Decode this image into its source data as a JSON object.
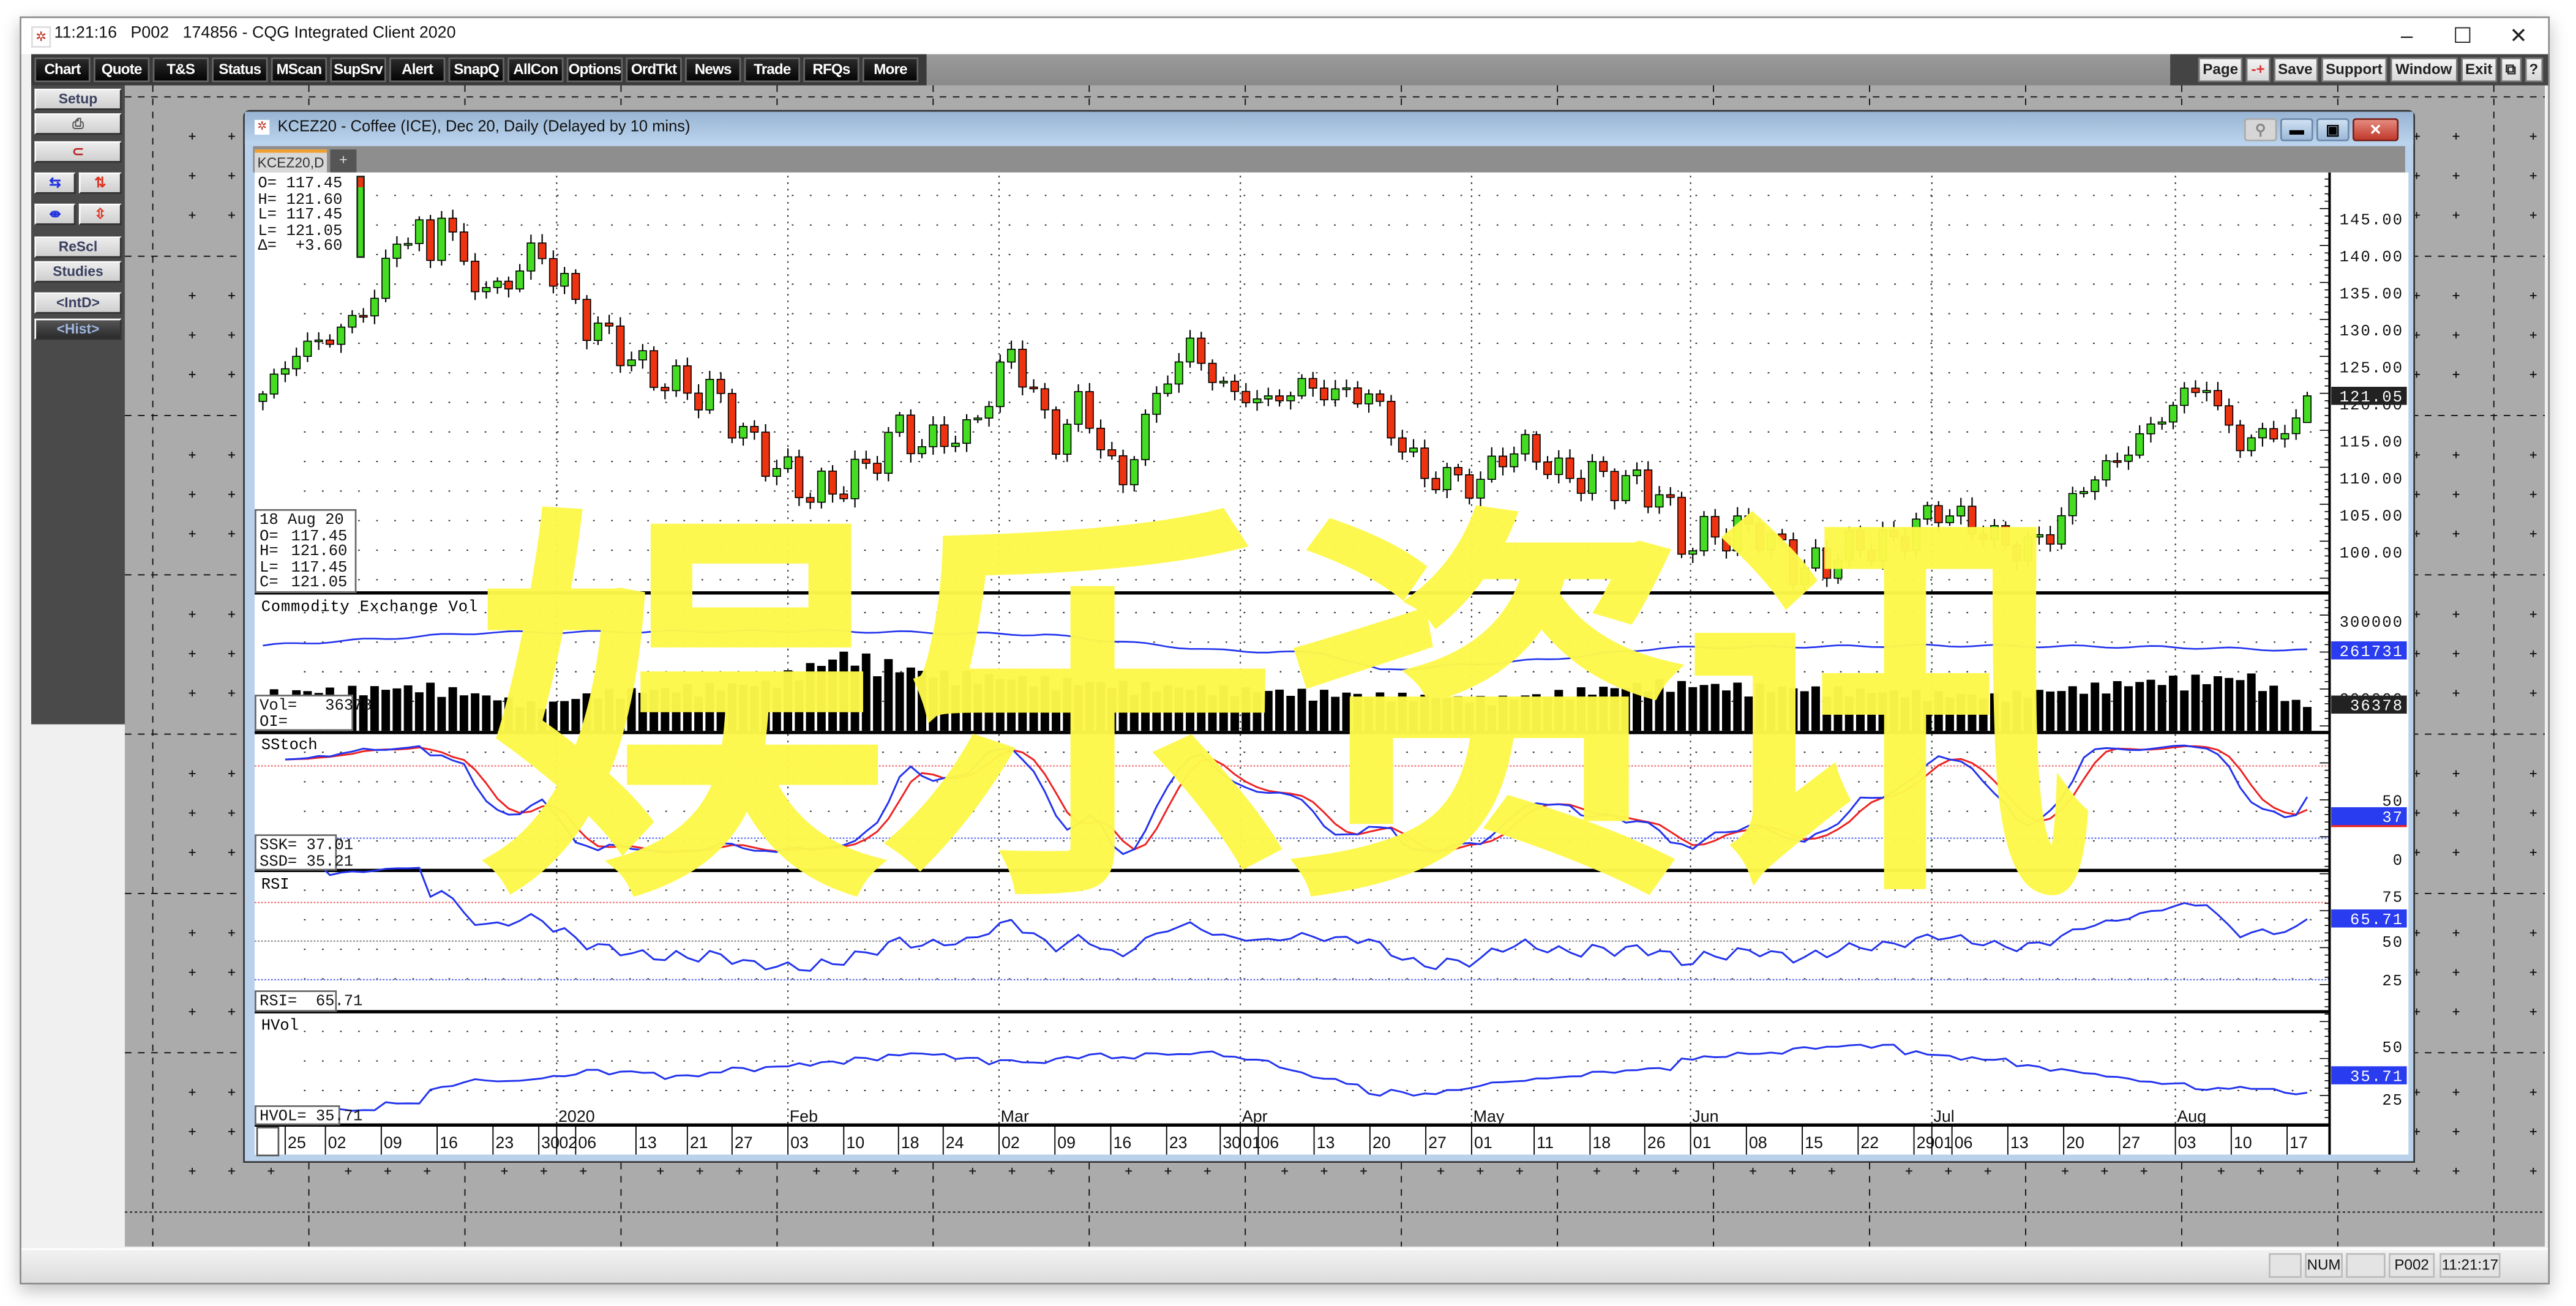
{
  "app": {
    "title": "11:21:16   P002   174856 - CQG Integrated Client 2020",
    "controls": {
      "minimize": "–",
      "maximize": "☐",
      "close": "✕"
    }
  },
  "toolbar": {
    "left": [
      "Chart",
      "Quote",
      "T&S",
      "Status",
      "MScan",
      "SupSrv",
      "Alert",
      "SnapQ",
      "AllCon",
      "Options",
      "OrdTkt",
      "News",
      "Trade",
      "RFQs",
      "More"
    ],
    "right": [
      "Page",
      "-+",
      "Save",
      "Support",
      "Window",
      "Exit"
    ],
    "restore_icon": "⧉",
    "help": "?"
  },
  "side_panel": {
    "setup": "Setup",
    "rescl": "ReScl",
    "studies": "Studies",
    "intd": "<IntD>",
    "hist": "<Hist>"
  },
  "chart_window": {
    "title": "KCEZ20 - Coffee (ICE), Dec 20, Daily (Delayed by 10 mins)",
    "tab": "KCEZ20,D",
    "add_tab": "+"
  },
  "ohlc_box": [
    {
      "k": "O=",
      "v": "117.45"
    },
    {
      "k": "H=",
      "v": "121.60"
    },
    {
      "k": "L=",
      "v": "117.45"
    },
    {
      "k": "L=",
      "v": "121.05"
    },
    {
      "k": "Δ=",
      "v": "+3.60"
    }
  ],
  "cursor_box": {
    "date": "18 Aug 20",
    "rows": [
      {
        "k": "O=",
        "v": "117.45"
      },
      {
        "k": "H=",
        "v": "121.60"
      },
      {
        "k": "L=",
        "v": "117.45"
      },
      {
        "k": "C=",
        "v": "121.05"
      }
    ]
  },
  "panels": {
    "volume": {
      "title": "Commodity Exchange Vol",
      "vol_label": "Vol=",
      "vol_value": "36378",
      "oi_label": "OI=",
      "oi_value": ""
    },
    "stoch": {
      "title": "SStoch",
      "ssk_label": "SSK=",
      "ssk_value": "37.01",
      "ssd_label": "SSD=",
      "ssd_value": "35.21"
    },
    "rsi": {
      "title": "RSI",
      "label": "RSI=",
      "value": "65.71"
    },
    "hvol": {
      "title": "HVol",
      "label": "HVOL=",
      "value": "35.71"
    }
  },
  "axes": {
    "price_ticks": [
      "145.00",
      "140.00",
      "135.00",
      "130.00",
      "125.00",
      "120.00",
      "115.00",
      "110.00",
      "105.00",
      "100.00"
    ],
    "price_current": "121.05",
    "volume_ticks": [
      "300000",
      "200000"
    ],
    "oi_current": "261731",
    "volume_current": "36378",
    "stoch_ticks": [
      "50",
      "0"
    ],
    "stoch_current": "37",
    "rsi_ticks": [
      "75",
      "50",
      "25"
    ],
    "rsi_current": "65.71",
    "hvol_ticks": [
      "50",
      "25"
    ],
    "hvol_current": "35.71"
  },
  "status_bar": {
    "num": "NUM",
    "page": "P002",
    "time": "11:21:17"
  },
  "watermark": "娱乐资讯",
  "colors": {
    "up": "#44dd22",
    "down": "#ee3311",
    "line_blue": "#2233ee",
    "line_red": "#ee2222",
    "watermark": "#fdf84a",
    "desktop": "#ababab"
  },
  "chart_data": {
    "type": "candlestick",
    "symbol": "KCEZ20",
    "bar_count": 184,
    "last_bar": {
      "open": 117.45,
      "high": 121.6,
      "low": 117.45,
      "close": 121.05
    },
    "ylim": [
      96,
      150
    ],
    "price_waypoints": [
      [
        0,
        121.3
      ],
      [
        3,
        127
      ],
      [
        6,
        129
      ],
      [
        8,
        131
      ],
      [
        10,
        134.6
      ],
      [
        12,
        142
      ],
      [
        14,
        143.5
      ],
      [
        15,
        139
      ],
      [
        16,
        146.7
      ],
      [
        18,
        138
      ],
      [
        21,
        134.6
      ],
      [
        23,
        139
      ],
      [
        25,
        140
      ],
      [
        27,
        135.7
      ],
      [
        29,
        131
      ],
      [
        32,
        127.5
      ],
      [
        34,
        124.6
      ],
      [
        37,
        122.4
      ],
      [
        41,
        120.6
      ],
      [
        43,
        115.7
      ],
      [
        46,
        111.3
      ],
      [
        49,
        108
      ],
      [
        51,
        108.4
      ],
      [
        54,
        111.3
      ],
      [
        57,
        116.8
      ],
      [
        59,
        114.2
      ],
      [
        61,
        115.7
      ],
      [
        63,
        115.7
      ],
      [
        65,
        121.3
      ],
      [
        67,
        126.8
      ],
      [
        69,
        121.3
      ],
      [
        71,
        114.6
      ],
      [
        73,
        120.2
      ],
      [
        75,
        114.6
      ],
      [
        77,
        109
      ],
      [
        79,
        118
      ],
      [
        81,
        123.5
      ],
      [
        83,
        128
      ],
      [
        85,
        123.5
      ],
      [
        87,
        121.3
      ],
      [
        90,
        120.2
      ],
      [
        93,
        122.4
      ],
      [
        96,
        121.3
      ],
      [
        99,
        121.3
      ],
      [
        101,
        116.4
      ],
      [
        104,
        110.2
      ],
      [
        107,
        109.7
      ],
      [
        109,
        109
      ],
      [
        111,
        113.5
      ],
      [
        114,
        113.5
      ],
      [
        116,
        110.2
      ],
      [
        119,
        110.2
      ],
      [
        123,
        109
      ],
      [
        125,
        108
      ],
      [
        127,
        101.3
      ],
      [
        130,
        102.4
      ],
      [
        134,
        103
      ],
      [
        137,
        98
      ],
      [
        140,
        98
      ],
      [
        141,
        100.2
      ],
      [
        146,
        101.3
      ],
      [
        150,
        105.8
      ],
      [
        153,
        103.5
      ],
      [
        157,
        100.2
      ],
      [
        160,
        102.4
      ],
      [
        163,
        109
      ],
      [
        166,
        112.4
      ],
      [
        169,
        116.8
      ],
      [
        172,
        121.3
      ],
      [
        174,
        122.4
      ],
      [
        175,
        119
      ],
      [
        177,
        114.6
      ],
      [
        179,
        115.7
      ],
      [
        182,
        116.8
      ],
      [
        183,
        121.05
      ]
    ],
    "volume_waypoints": [
      [
        0,
        60000
      ],
      [
        15,
        70000
      ],
      [
        25,
        40000
      ],
      [
        30,
        60000
      ],
      [
        45,
        75000
      ],
      [
        52,
        120000
      ],
      [
        60,
        90000
      ],
      [
        80,
        70000
      ],
      [
        95,
        60000
      ],
      [
        110,
        50000
      ],
      [
        125,
        75000
      ],
      [
        140,
        65000
      ],
      [
        155,
        55000
      ],
      [
        170,
        80000
      ],
      [
        178,
        85000
      ],
      [
        183,
        36378
      ]
    ],
    "open_interest_waypoints": [
      [
        0,
        268000
      ],
      [
        12,
        278000
      ],
      [
        20,
        285000
      ],
      [
        50,
        287000
      ],
      [
        70,
        282000
      ],
      [
        85,
        262000
      ],
      [
        95,
        258000
      ],
      [
        100,
        236000
      ],
      [
        115,
        250000
      ],
      [
        125,
        265000
      ],
      [
        150,
        268000
      ],
      [
        170,
        266000
      ],
      [
        183,
        261731
      ]
    ],
    "date_ticks": [
      {
        "bar": 2,
        "label": "25"
      },
      {
        "bar": 5.6,
        "label": "02"
      },
      {
        "bar": 10.6,
        "label": "09"
      },
      {
        "bar": 15.6,
        "label": "16"
      },
      {
        "bar": 20.6,
        "label": "23"
      },
      {
        "bar": 24.7,
        "label": "30"
      },
      {
        "bar": 26.3,
        "label": "02",
        "month": "2020"
      },
      {
        "bar": 28,
        "label": "06"
      },
      {
        "bar": 33.4,
        "label": "13"
      },
      {
        "bar": 38,
        "label": "21"
      },
      {
        "bar": 42,
        "label": "27"
      },
      {
        "bar": 47,
        "label": "03",
        "month": "Feb"
      },
      {
        "bar": 52,
        "label": "10"
      },
      {
        "bar": 56.9,
        "label": "18"
      },
      {
        "bar": 60.9,
        "label": "24"
      },
      {
        "bar": 65.9,
        "label": "02",
        "month": "Mar"
      },
      {
        "bar": 70.9,
        "label": "09"
      },
      {
        "bar": 75.9,
        "label": "16"
      },
      {
        "bar": 80.9,
        "label": "23"
      },
      {
        "bar": 85.7,
        "label": "30"
      },
      {
        "bar": 87.5,
        "label": "01",
        "month": "Apr"
      },
      {
        "bar": 89.1,
        "label": "06"
      },
      {
        "bar": 94.1,
        "label": "13"
      },
      {
        "bar": 99.1,
        "label": "20"
      },
      {
        "bar": 104.1,
        "label": "27"
      },
      {
        "bar": 108.2,
        "label": "01",
        "month": "May"
      },
      {
        "bar": 113.8,
        "label": "11"
      },
      {
        "bar": 118.8,
        "label": "18"
      },
      {
        "bar": 123.7,
        "label": "26"
      },
      {
        "bar": 127.8,
        "label": "01",
        "month": "Jun"
      },
      {
        "bar": 132.8,
        "label": "08"
      },
      {
        "bar": 137.8,
        "label": "15"
      },
      {
        "bar": 142.8,
        "label": "22"
      },
      {
        "bar": 147.8,
        "label": "29"
      },
      {
        "bar": 149.4,
        "label": "01",
        "month": "Jul"
      },
      {
        "bar": 151.2,
        "label": "06"
      },
      {
        "bar": 156.2,
        "label": "13"
      },
      {
        "bar": 161.2,
        "label": "20"
      },
      {
        "bar": 166.2,
        "label": "27"
      },
      {
        "bar": 171.2,
        "label": "03",
        "month": "Aug"
      },
      {
        "bar": 176.2,
        "label": "10"
      },
      {
        "bar": 181.2,
        "label": "17"
      }
    ],
    "studies": {
      "stoch_levels": [
        80,
        20
      ],
      "rsi_levels": [
        75,
        50,
        25
      ],
      "hvol_levels": [
        50,
        25
      ]
    }
  }
}
